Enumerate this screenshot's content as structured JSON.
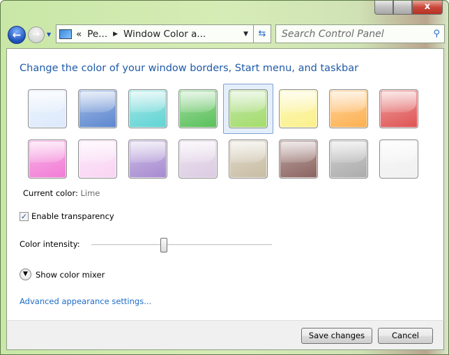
{
  "titlebar": {
    "close_glyph": "x"
  },
  "nav": {
    "breadcrumb": [
      "«",
      "Pe...",
      "Window Color a..."
    ],
    "search_placeholder": "Search Control Panel"
  },
  "main": {
    "title": "Change the color of your window borders, Start menu, and taskbar",
    "swatches": [
      "#dce9fb",
      "#5b86cf",
      "#5fd3d3",
      "#58c058",
      "#a4dd6a",
      "#fbf08a",
      "#fdb04f",
      "#df5252",
      "#f27ad5",
      "#f9d4f3",
      "#a68ad0",
      "#dccbe2",
      "#c8bda3",
      "#8a625e",
      "#ababab",
      "#f0f0f0"
    ],
    "selected_index": 4,
    "current_color_label": "Current color:",
    "current_color_value": "Lime",
    "transparency_label": "Enable transparency",
    "transparency_checked": true,
    "intensity_label": "Color intensity:",
    "intensity_percent": 40,
    "mixer_label": "Show color mixer",
    "advanced_link": "Advanced appearance settings..."
  },
  "footer": {
    "save": "Save changes",
    "cancel": "Cancel"
  },
  "colors": {
    "link": "#1e6cc8",
    "title": "#1e5aa8"
  }
}
